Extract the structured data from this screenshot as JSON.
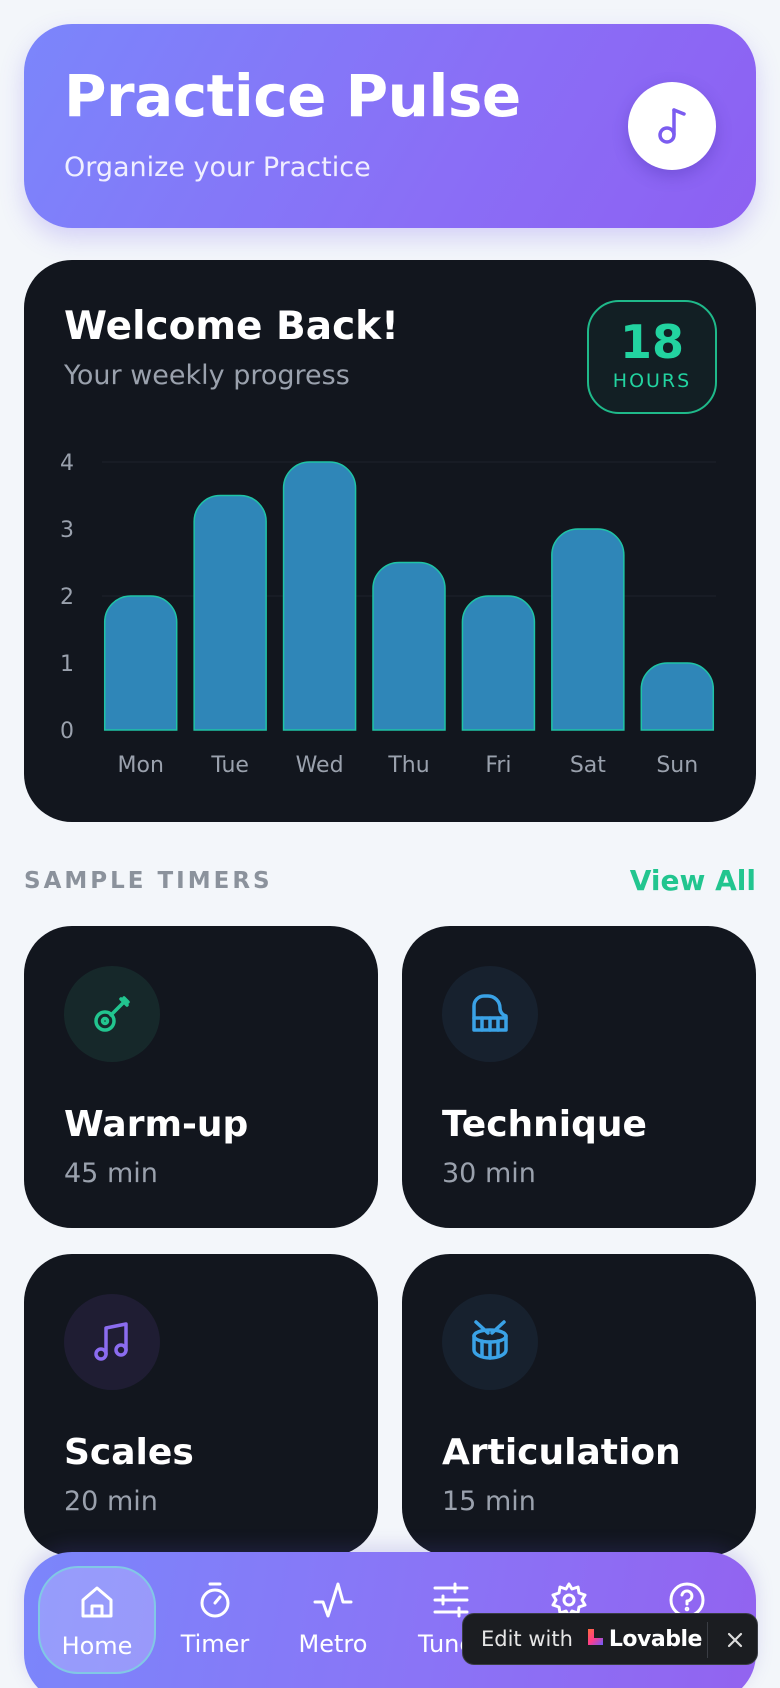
{
  "header": {
    "title": "Practice Pulse",
    "subtitle": "Organize your Practice",
    "logo_icon": "music-note-icon"
  },
  "weekly": {
    "title": "Welcome Back!",
    "subtitle": "Your weekly progress",
    "hours_value": "18",
    "hours_unit": "HOURS"
  },
  "chart_data": {
    "type": "bar",
    "categories": [
      "Mon",
      "Tue",
      "Wed",
      "Thu",
      "Fri",
      "Sat",
      "Sun"
    ],
    "values": [
      2.0,
      3.5,
      4.0,
      2.5,
      2.0,
      3.0,
      1.0
    ],
    "yticks": [
      "0",
      "1",
      "2",
      "3",
      "4"
    ],
    "ylim": [
      0,
      4
    ],
    "bar_color": "#2f86b8",
    "bar_stroke": "#1fc4a6"
  },
  "section": {
    "label": "SAMPLE TIMERS",
    "view_all": "View All"
  },
  "timers": [
    {
      "title": "Warm-up",
      "duration": "45 min",
      "icon": "guitar-icon",
      "accent": "#22c58f",
      "bg": "#16282a"
    },
    {
      "title": "Technique",
      "duration": "30 min",
      "icon": "piano-icon",
      "accent": "#3aa2e6",
      "bg": "#17212e"
    },
    {
      "title": "Scales",
      "duration": "20 min",
      "icon": "music-notes-icon",
      "accent": "#8b6cf0",
      "bg": "#1f1d33"
    },
    {
      "title": "Articulation",
      "duration": "15 min",
      "icon": "drum-icon",
      "accent": "#3aa2e6",
      "bg": "#17212e"
    }
  ],
  "nav": [
    {
      "label": "Home",
      "icon": "home-icon",
      "active": true
    },
    {
      "label": "Timer",
      "icon": "timer-icon",
      "active": false
    },
    {
      "label": "Metro",
      "icon": "pulse-icon",
      "active": false
    },
    {
      "label": "Tuner",
      "icon": "sliders-icon",
      "active": false
    },
    {
      "label": "Settings",
      "icon": "gear-icon",
      "active": false
    },
    {
      "label": "Help",
      "icon": "help-icon",
      "active": false
    }
  ],
  "badge": {
    "text": "Edit with",
    "brand": "Lovable",
    "close_icon": "close-icon"
  }
}
